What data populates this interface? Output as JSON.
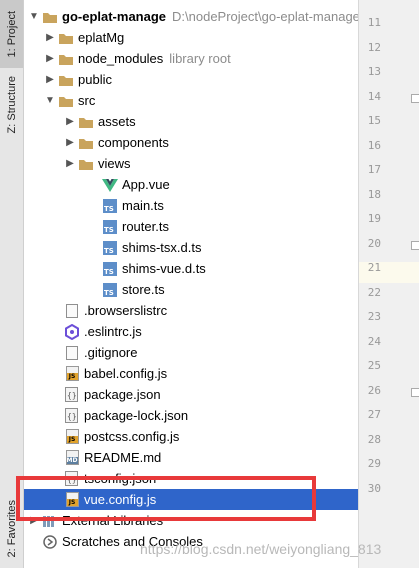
{
  "side_tabs": {
    "project": "1: Project",
    "structure": "Z: Structure",
    "favorites": "2: Favorites"
  },
  "tree": {
    "root": {
      "name": "go-eplat-manage",
      "path": "D:\\nodeProject\\go-eplat-manage"
    },
    "eplatMg": "eplatMg",
    "node_modules": "node_modules",
    "library_root": "library root",
    "public": "public",
    "src": "src",
    "assets": "assets",
    "components": "components",
    "views": "views",
    "app_vue": "App.vue",
    "main_ts": "main.ts",
    "router_ts": "router.ts",
    "shims_tsx": "shims-tsx.d.ts",
    "shims_vue": "shims-vue.d.ts",
    "store_ts": "store.ts",
    "browserslistrc": ".browserslistrc",
    "eslintrc": ".eslintrc.js",
    "gitignore": ".gitignore",
    "babel_config": "babel.config.js",
    "package_json": "package.json",
    "package_lock": "package-lock.json",
    "postcss_config": "postcss.config.js",
    "readme": "README.md",
    "tsconfig": "tsconfig.json",
    "vue_config": "vue.config.js",
    "external_libraries": "External Libraries",
    "scratches": "Scratches and Consoles"
  },
  "gutter_lines": [
    "11",
    "12",
    "13",
    "14",
    "15",
    "16",
    "17",
    "18",
    "19",
    "20",
    "21",
    "22",
    "23",
    "24",
    "25",
    "26",
    "27",
    "28",
    "29",
    "30"
  ],
  "watermark": "https://blog.csdn.net/weiyongliang_813",
  "colors": {
    "selection": "#2f65ca",
    "highlight_box": "#e8393a",
    "folder": "#c9a45d",
    "vue": "#41b883"
  }
}
